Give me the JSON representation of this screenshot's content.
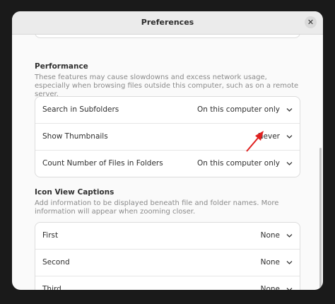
{
  "window": {
    "title": "Preferences"
  },
  "icons": {
    "close": "close-icon",
    "chevron": "chevron-down-icon"
  },
  "colors": {
    "annotation_arrow": "#e0201f"
  },
  "performance": {
    "title": "Performance",
    "description": "These features may cause slowdowns and excess network usage, especially when browsing files outside this computer, such as on a remote server.",
    "rows": [
      {
        "label": "Search in Subfolders",
        "value": "On this computer only"
      },
      {
        "label": "Show Thumbnails",
        "value": "Never"
      },
      {
        "label": "Count Number of Files in Folders",
        "value": "On this computer only"
      }
    ]
  },
  "captions": {
    "title": "Icon View Captions",
    "description": "Add information to be displayed beneath file and folder names. More information will appear when zooming closer.",
    "rows": [
      {
        "label": "First",
        "value": "None"
      },
      {
        "label": "Second",
        "value": "None"
      },
      {
        "label": "Third",
        "value": "None"
      }
    ]
  }
}
